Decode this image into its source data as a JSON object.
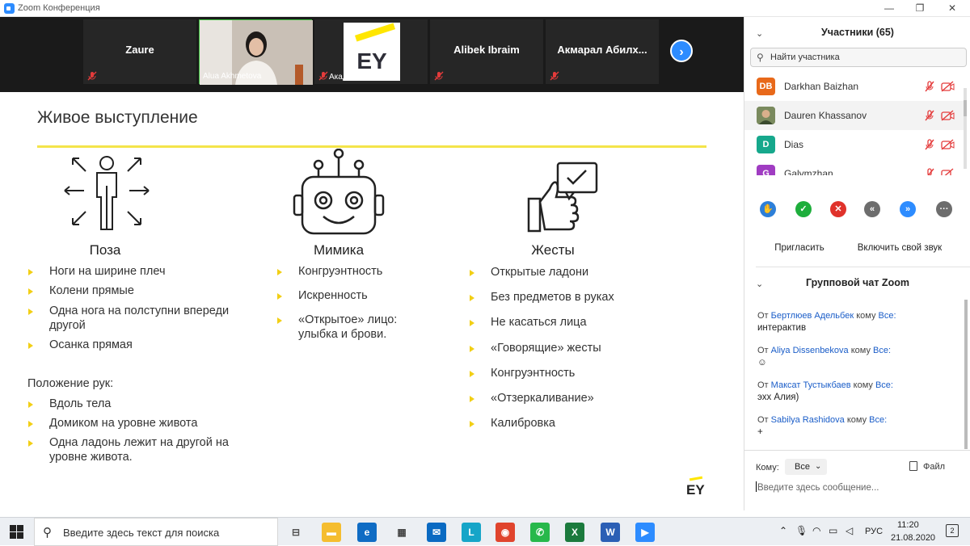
{
  "window": {
    "title": "Zoom Конференция",
    "controls": [
      "—",
      "❐",
      "✕"
    ]
  },
  "video": {
    "tiles": [
      {
        "name": "Zaure",
        "label": ""
      },
      {
        "name": "",
        "label": "Alua Akhmetova"
      },
      {
        "name": "EY",
        "label": "Академия би..."
      },
      {
        "name": "Alibek Ibraim",
        "label": ""
      },
      {
        "name": "Акмарал  Абилх...",
        "label": ""
      }
    ],
    "next_label": "›"
  },
  "slide": {
    "title": "Живое выступление",
    "columns": [
      {
        "heading": "Поза",
        "items": [
          "Ноги на ширине плеч",
          "Колени прямые",
          "Одна нога на полступни впереди",
          "другой",
          "Осанка прямая"
        ]
      },
      {
        "heading": "Мимика",
        "items": [
          "Конгруэнтность",
          "Искренность",
          "«Открытое» лицо:",
          "улыбка и брови."
        ]
      },
      {
        "heading": "Жесты",
        "items": [
          "Открытые ладони",
          "Без предметов в руках",
          "Не касаться лица",
          "«Говорящие» жесты",
          "Конгруэнтность",
          "«Отзеркаливание»",
          "Калибровка"
        ]
      }
    ],
    "hands_heading": "Положение рук:",
    "hands_items": [
      "Вдоль тела",
      "Домиком на уровне живота",
      "Одна ладонь лежит на другой на",
      "уровне живота."
    ],
    "logo": "EY"
  },
  "participants": {
    "title": "Участники (65)",
    "search_placeholder": "Найти участника",
    "list": [
      {
        "initials": "DB",
        "name": "Darkhan Baizhan",
        "color": "#e8691a"
      },
      {
        "initials": "",
        "name": "Dauren Khassanov",
        "color": "#7a8a5e"
      },
      {
        "initials": "D",
        "name": "Dias",
        "color": "#16a88c"
      },
      {
        "initials": "G",
        "name": "Galymzhan",
        "color": "#a03cc2"
      }
    ],
    "actions": [
      "✋",
      "✓",
      "✕",
      "«",
      "»",
      "···"
    ],
    "action_colors": [
      "#2d7fd8",
      "#1eae3c",
      "#e0322b",
      "#6d6d6d",
      "#2d8cff",
      "#6d6d6d"
    ],
    "invite": "Пригласить",
    "unmute": "Включить свой звук"
  },
  "chat": {
    "title": "Групповой чат Zoom",
    "messages": [
      {
        "from": "Бертлюев Адельбек",
        "to": "Все:",
        "text": "интерактив"
      },
      {
        "from": "Aliya Dissenbekova",
        "to": "Все:",
        "text": "☺"
      },
      {
        "from": "Максат Тустыкбаев",
        "to": "Все:",
        "text": "эхх Алия)"
      },
      {
        "from": "Sabilya Rashidova",
        "to": "Все:",
        "text": "+"
      }
    ],
    "from_word": "От",
    "to_word": "кому",
    "to_label": "Кому:",
    "to_value": "Все",
    "file_label": "Файл",
    "input_placeholder": "Введите здесь сообщение..."
  },
  "taskbar": {
    "search_placeholder": "Введите здесь текст для поиска",
    "apps": [
      "task-view",
      "explorer",
      "edge",
      "store",
      "mail",
      "lingvo",
      "chrome",
      "whatsapp",
      "excel",
      "word",
      "zoom"
    ],
    "app_labels": [
      "⊟",
      "▬",
      "e",
      "▦",
      "✉",
      "L",
      "◉",
      "✆",
      "X",
      "W",
      "▶"
    ],
    "app_colors": [
      "#555",
      "#f5bd2f",
      "#0f6cc4",
      "#444",
      "#0a6ac2",
      "#16a5c8",
      "#e0442d",
      "#27b84b",
      "#1b7a3d",
      "#2b5fb5",
      "#2d8cff"
    ],
    "lang": "РУС",
    "time": "11:20",
    "date": "21.08.2020",
    "notif_count": "2"
  }
}
